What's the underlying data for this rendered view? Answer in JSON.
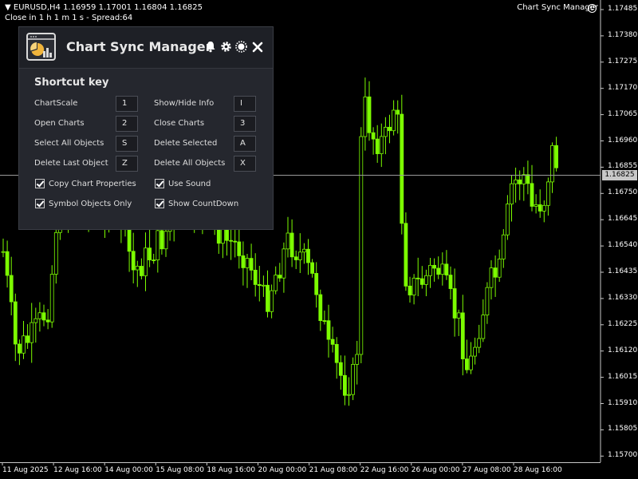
{
  "chart": {
    "symbol_line": "EURUSD,H4  1.16959 1.17001 1.16804 1.16825",
    "countdown_line": "Close in 1 h 1 m 1 s - Spread:64",
    "ea_name": "Chart Sync Manager",
    "current_price": "1.16825",
    "price_levels": [
      "1.17485",
      "1.17380",
      "1.17275",
      "1.17170",
      "1.17065",
      "1.16960",
      "1.16855",
      "1.16750",
      "1.16645",
      "1.16540",
      "1.16435",
      "1.16330",
      "1.16225",
      "1.16120",
      "1.16015",
      "1.15910",
      "1.15805",
      "1.15700"
    ],
    "date_labels": [
      "11 Aug 2025",
      "12 Aug 16:00",
      "14 Aug 00:00",
      "15 Aug 08:00",
      "18 Aug 16:00",
      "20 Aug 00:00",
      "21 Aug 08:00",
      "22 Aug 16:00",
      "26 Aug 00:00",
      "27 Aug 08:00",
      "28 Aug 16:00"
    ],
    "candle_color": "#7CFC00",
    "background": "#000000"
  },
  "panel": {
    "title": "Chart Sync Manager",
    "section_title": "Shortcut key",
    "shortcuts": [
      {
        "label": "ChartScale",
        "key": "1"
      },
      {
        "label": "Show/Hide Info",
        "key": "I"
      },
      {
        "label": "Open Charts",
        "key": "2"
      },
      {
        "label": "Close Charts",
        "key": "3"
      },
      {
        "label": "Select All Objects",
        "key": "S"
      },
      {
        "label": "Delete Selected",
        "key": "A"
      },
      {
        "label": "Delete Last Object",
        "key": "Z"
      },
      {
        "label": "Delete All Objects",
        "key": "X"
      }
    ],
    "options": [
      {
        "label": "Copy Chart Properties",
        "checked": true
      },
      {
        "label": "Use Sound",
        "checked": true
      },
      {
        "label": "Symbol Objects Only",
        "checked": true
      },
      {
        "label": "Show CountDown",
        "checked": true
      }
    ],
    "icons": [
      "chart-sync-logo-icon",
      "bell-icon",
      "gear-icon",
      "sun-icon",
      "close-icon"
    ]
  }
}
